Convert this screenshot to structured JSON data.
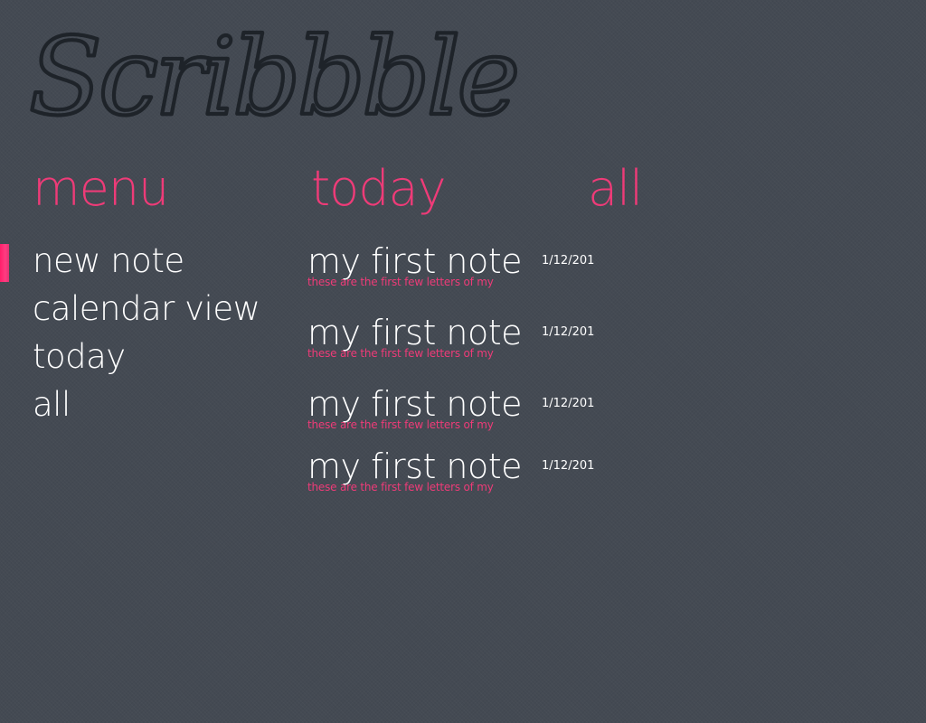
{
  "app": {
    "logo_text": "Scribbble"
  },
  "colors": {
    "background": "#444a53",
    "accent": "#ee3b78",
    "text": "#ffffff",
    "logo_stroke": "#1e2329"
  },
  "headers": {
    "menu": "menu",
    "today": "today",
    "all": "all"
  },
  "menu": {
    "selected_index": 0,
    "items": [
      {
        "label": "new note"
      },
      {
        "label": "calendar view"
      },
      {
        "label": "today"
      },
      {
        "label": "all"
      }
    ]
  },
  "today": {
    "notes": [
      {
        "title": "my first note",
        "date": "1/12/201",
        "preview": "these are the first few letters of my"
      },
      {
        "title": "my first note",
        "date": "1/12/201",
        "preview": "these are the first few letters of my"
      },
      {
        "title": "my first note",
        "date": "1/12/201",
        "preview": "these are the first few letters of my"
      },
      {
        "title": "my first note",
        "date": "1/12/201",
        "preview": "these are the first few letters of my"
      }
    ]
  }
}
